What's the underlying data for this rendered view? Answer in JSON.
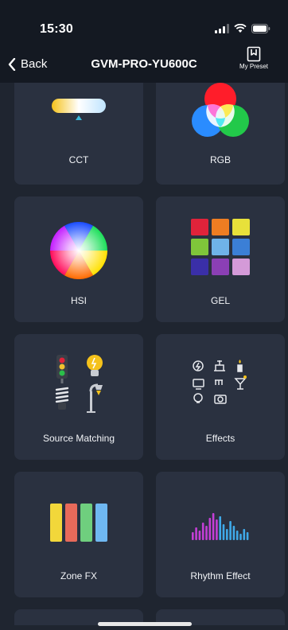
{
  "status_bar": {
    "time": "15:30"
  },
  "nav": {
    "back_label": "Back",
    "title": "GVM-PRO-YU600C",
    "preset_label": "My Preset"
  },
  "modes": [
    {
      "label": "CCT"
    },
    {
      "label": "RGB"
    },
    {
      "label": "HSI"
    },
    {
      "label": "GEL"
    },
    {
      "label": "Source Matching"
    },
    {
      "label": "Effects"
    },
    {
      "label": "Zone FX"
    },
    {
      "label": "Rhythm Effect"
    }
  ],
  "colors": {
    "background": "#1f2530",
    "card": "#2a3140",
    "header": "#141922",
    "accent": "#3ab8d8"
  },
  "gel_swatches": [
    "#e0233a",
    "#ee7d22",
    "#e8e13a",
    "#7fc63a",
    "#6fb3e8",
    "#3b7fd6",
    "#3a2fa8",
    "#8b3fb5",
    "#d49ad8"
  ],
  "zone_fx_colors": [
    "#f2d73a",
    "#e86a5a",
    "#6fcf7e",
    "#6fb8f2"
  ],
  "icons": [
    "chevron-left-icon",
    "signal-icon",
    "wifi-icon",
    "battery-icon",
    "bookmark-icon"
  ]
}
